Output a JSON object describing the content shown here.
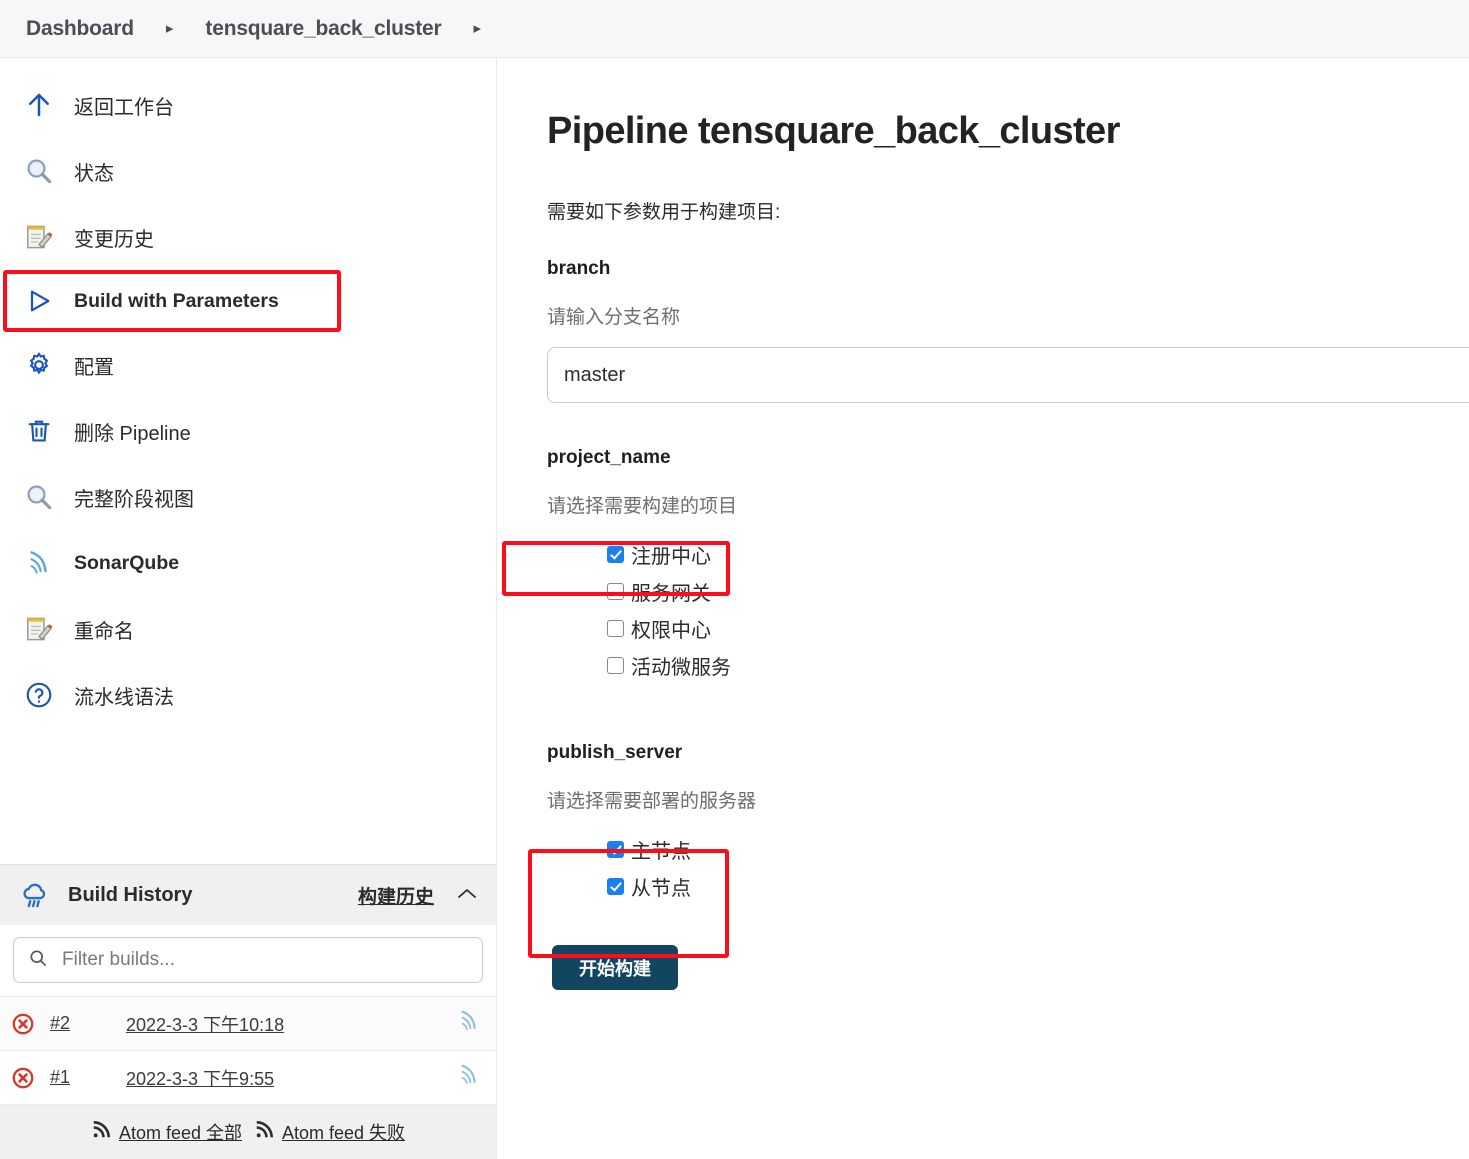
{
  "breadcrumb": {
    "items": [
      "Dashboard",
      "tensquare_back_cluster"
    ],
    "separator": "▸"
  },
  "sidebar": {
    "tasks": [
      {
        "label": "返回工作台",
        "icon": "arrow-up-icon",
        "bold": false
      },
      {
        "label": "状态",
        "icon": "magnifier-icon",
        "bold": false
      },
      {
        "label": "变更历史",
        "icon": "notepad-pencil-icon",
        "bold": false
      },
      {
        "label": "Build with Parameters",
        "icon": "play-triangle-icon",
        "bold": true
      },
      {
        "label": "配置",
        "icon": "gear-icon",
        "bold": false
      },
      {
        "label": "删除 Pipeline",
        "icon": "trash-icon",
        "bold": false
      },
      {
        "label": "完整阶段视图",
        "icon": "magnifier-icon",
        "bold": false
      },
      {
        "label": "SonarQube",
        "icon": "sonarqube-icon",
        "bold": true
      },
      {
        "label": "重命名",
        "icon": "notepad-pencil-icon",
        "bold": false
      },
      {
        "label": "流水线语法",
        "icon": "question-circle-icon",
        "bold": false
      }
    ],
    "build_history": {
      "title": "Build History",
      "link_label": "构建历史",
      "collapse_icon": "chevron-up-icon",
      "cloud_icon": "weather-cloud-icon",
      "filter_placeholder": "Filter builds...",
      "filter_value": "",
      "search_icon": "search-icon",
      "rows": [
        {
          "status": "failed",
          "number": "#2",
          "time": "2022-3-3 下午10:18",
          "feed_icon": "sonarqube-icon"
        },
        {
          "status": "failed",
          "number": "#1",
          "time": "2022-3-3 下午9:55",
          "feed_icon": "sonarqube-icon"
        }
      ],
      "footer_links": [
        {
          "label": "Atom feed 全部",
          "icon": "rss-icon"
        },
        {
          "label": "Atom feed 失败",
          "icon": "rss-icon"
        }
      ]
    }
  },
  "main": {
    "title": "Pipeline tensquare_back_cluster",
    "intro": "需要如下参数用于构建项目:",
    "params": [
      {
        "name": "branch",
        "description": "请输入分支名称",
        "type": "text",
        "value": "master",
        "placeholder": ""
      },
      {
        "name": "project_name",
        "description": "请选择需要构建的项目",
        "type": "checkbox-group",
        "options": [
          {
            "label": "注册中心",
            "checked": true
          },
          {
            "label": "服务网关",
            "checked": false
          },
          {
            "label": "权限中心",
            "checked": false
          },
          {
            "label": "活动微服务",
            "checked": false
          }
        ]
      },
      {
        "name": "publish_server",
        "description": "请选择需要部署的服务器",
        "type": "checkbox-group",
        "options": [
          {
            "label": "主节点",
            "checked": true
          },
          {
            "label": "从节点",
            "checked": true
          }
        ]
      }
    ],
    "submit_label": "开始构建"
  },
  "colors": {
    "highlight_red": "#fc0d1b",
    "accent_blue": "#1a55b8",
    "checkbox_blue": "#1a7ff0",
    "button_navy": "#114560",
    "failure_red": "#d5372b",
    "breadcrumb_bg": "#f7f7f8"
  }
}
